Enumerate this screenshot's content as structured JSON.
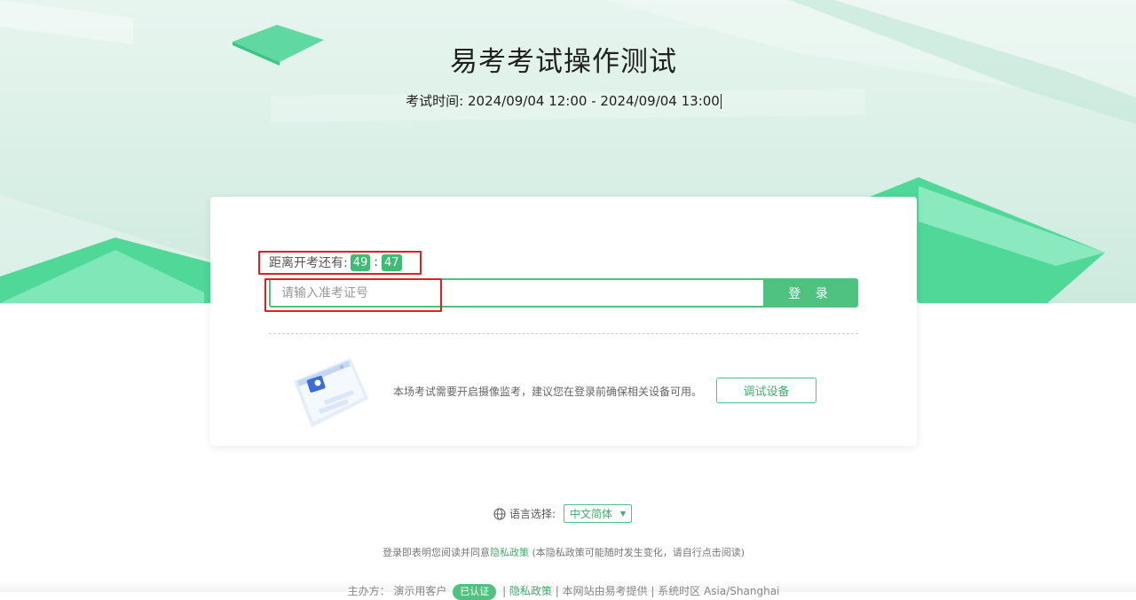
{
  "header": {
    "title": "易考考试操作测试",
    "exam_time": "考试时间: 2024/09/04 12:00 - 2024/09/04 13:00"
  },
  "login": {
    "countdown_label": "距离开考还有:",
    "countdown_minutes": "49",
    "countdown_seconds": "47",
    "ticket_placeholder": "请输入准考证号",
    "login_button": "登 录"
  },
  "device_check": {
    "notice": "本场考试需要开启摄像监考，建议您在登录前确保相关设备可用。",
    "test_button": "调试设备"
  },
  "language": {
    "label": "语言选择:",
    "selected": "中文简体"
  },
  "consent": {
    "prefix": "登录即表明您阅读并同意",
    "policy_link": "隐私政策",
    "suffix": " (本隐私政策可能随时发生变化，请自行点击阅读)"
  },
  "footer": {
    "organizer": "主办方：  演示用客户",
    "badge": "已认证",
    "policy_link": "隐私政策",
    "provider": " | 本网站由易考提供 | 系统时区 Asia/Shanghai"
  },
  "colors": {
    "accent": "#4fc27f",
    "highlight_frame": "#e02020"
  }
}
